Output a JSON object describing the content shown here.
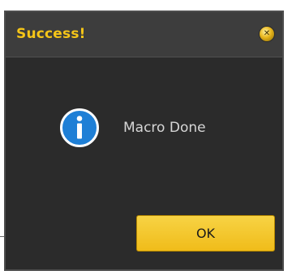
{
  "dialog": {
    "title": "Success!",
    "message": "Macro Done",
    "ok_label": "OK",
    "icons": {
      "close": "close-icon",
      "info": "info-icon"
    }
  },
  "colors": {
    "title": "#f5c518",
    "background": "#2b2b2b",
    "button": "#f0bc1a",
    "info_icon": "#1e7fd6"
  }
}
